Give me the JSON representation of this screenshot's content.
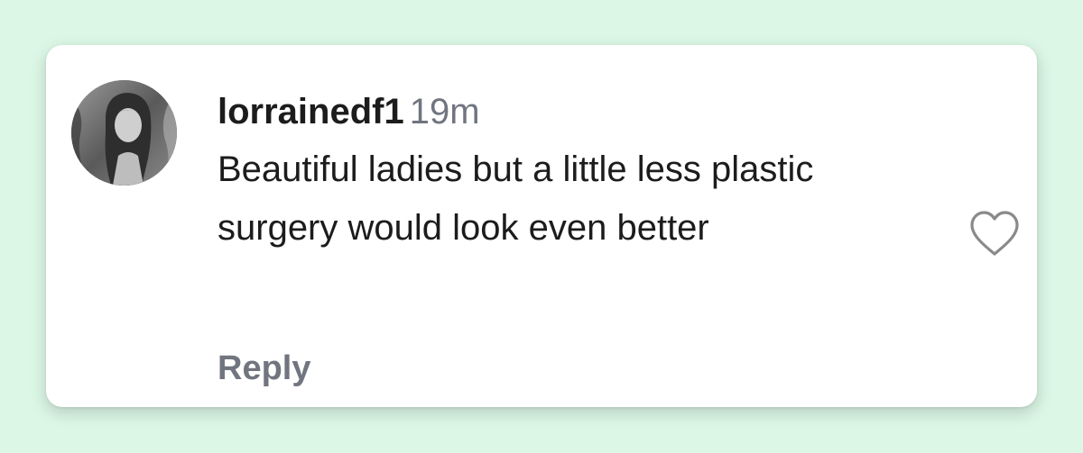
{
  "comment": {
    "username": "lorrainedf1",
    "timestamp": "19m",
    "text": "Beautiful ladies but a little less plastic surgery would look even better",
    "reply_label": "Reply"
  },
  "icons": {
    "avatar": "user-photo-avatar",
    "like": "heart-outline-icon"
  },
  "colors": {
    "background": "#dcf7e6",
    "card": "#ffffff",
    "primary_text": "#1c1c1c",
    "secondary_text": "#70757f"
  }
}
